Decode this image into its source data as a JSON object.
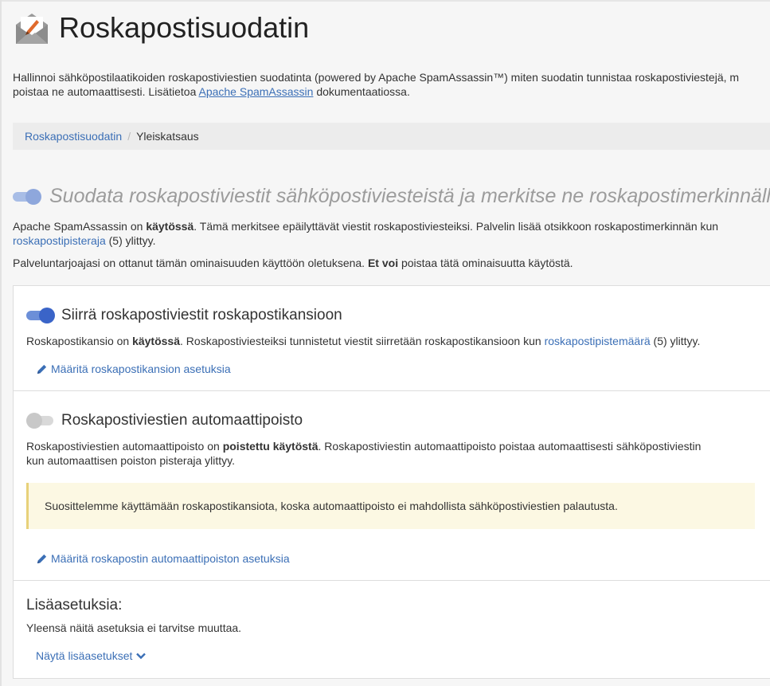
{
  "header": {
    "title": "Roskapostisuodatin",
    "icon": "envelope-pen-icon"
  },
  "intro": {
    "line1": "Hallinnoi sähköpostilaatikoiden roskapostiviestien suodatinta (powered by Apache SpamAssassin™) miten suodatin tunnistaa roskapostiviestejä, m",
    "line2_before": "poistaa ne automaattisesti. Lisätietoa ",
    "link": "Apache SpamAssassin",
    "line2_after": " dokumentaatiossa."
  },
  "breadcrumb": {
    "root": "Roskapostisuodatin",
    "separator": "/",
    "current": "Yleiskatsaus"
  },
  "main_toggle": {
    "label": "Suodata roskapostiviestit sähköpostiviesteistä ja merkitse ne roskapostimerkinnällä",
    "state": "on-disabled"
  },
  "status": {
    "p1_a": "Apache SpamAssassin on ",
    "p1_b": "käytössä",
    "p1_c": ". Tämä merkitsee epäilyttävät viestit roskapostiviesteiksi. Palvelin lisää otsikkoon roskapostimerkinnän kun",
    "p1_link": "roskapostipisteraja",
    "p1_d": " (5) ylittyy.",
    "p2_a": "Palveluntarjoajasi on ottanut tämän ominaisuuden käyttöön oletuksena. ",
    "p2_b": "Et voi",
    "p2_c": " poistaa tätä ominaisuutta käytöstä."
  },
  "move_section": {
    "title": "Siirrä roskapostiviestit roskapostikansioon",
    "toggle": "on",
    "t_a": "Roskapostikansio on ",
    "t_b": "käytössä",
    "t_c": ". Roskapostiviesteiksi tunnistetut viestit siirretään roskapostikansioon kun ",
    "t_link": "roskapostipistemäärä",
    "t_d": " (5) ylittyy.",
    "action": "Määritä roskapostikansion asetuksia"
  },
  "autodelete_section": {
    "title": "Roskapostiviestien automaattipoisto",
    "toggle": "off",
    "t_a": "Roskapostiviestien automaattipoisto on ",
    "t_b": "poistettu käytöstä",
    "t_c": ". Roskapostiviestin automaattipoisto poistaa automaattisesti sähköpostiviestin",
    "t_line2": "kun automaattisen poiston pisteraja ylittyy.",
    "warning": "Suosittelemme käyttämään roskapostikansiota, koska automaattipoisto ei mahdollista sähköpostiviestien palautusta.",
    "action": "Määritä roskapostin automaattipoiston asetuksia"
  },
  "more_section": {
    "title": "Lisäasetuksia:",
    "text": "Yleensä näitä asetuksia ei tarvitse muuttaa.",
    "action": "Näytä lisäasetukset"
  },
  "colors": {
    "link": "#3b6fb6",
    "toggle_on": "#3a64c8",
    "warning_bg": "#fcf8e3",
    "warning_border": "#e8d17a"
  }
}
